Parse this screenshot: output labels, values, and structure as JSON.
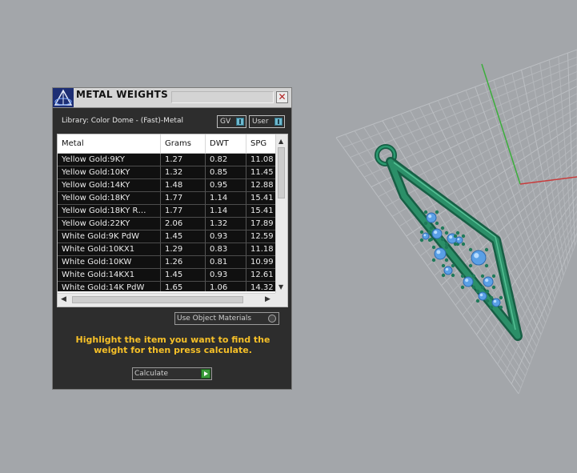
{
  "panel": {
    "title": "METAL WEIGHTS",
    "close_glyph": "✕",
    "library_label": "Library: Color Dome - (Fast)-Metal",
    "toggles": [
      {
        "label": "GV",
        "icon": "toggle-icon"
      },
      {
        "label": "User",
        "icon": "toggle-icon"
      }
    ],
    "table": {
      "columns": [
        "Metal",
        "Grams",
        "DWT",
        "SPG"
      ],
      "rows": [
        [
          "Yellow Gold:9KY",
          "1.27",
          "0.82",
          "11.08"
        ],
        [
          "Yellow Gold:10KY",
          "1.32",
          "0.85",
          "11.45"
        ],
        [
          "Yellow Gold:14KY",
          "1.48",
          "0.95",
          "12.88"
        ],
        [
          "Yellow Gold:18KY",
          "1.77",
          "1.14",
          "15.41"
        ],
        [
          "Yellow Gold:18KY R…",
          "1.77",
          "1.14",
          "15.41"
        ],
        [
          "Yellow Gold:22KY",
          "2.06",
          "1.32",
          "17.89"
        ],
        [
          "White Gold:9K PdW",
          "1.45",
          "0.93",
          "12.59"
        ],
        [
          "White Gold:10KX1",
          "1.29",
          "0.83",
          "11.18"
        ],
        [
          "White Gold:10KW",
          "1.26",
          "0.81",
          "10.99"
        ],
        [
          "White Gold:14KX1",
          "1.45",
          "0.93",
          "12.61"
        ],
        [
          "White Gold:14K PdW",
          "1.65",
          "1.06",
          "14.32"
        ]
      ]
    },
    "use_object_materials": "Use Object Materials",
    "hint": "Highlight the item you want to find the weight for then press calculate.",
    "calculate_label": "Calculate"
  },
  "colors": {
    "viewport_bg": "#a3a6aa",
    "panel_bg": "#2d2d2d",
    "hint_text": "#f6c028",
    "model_green": "#1f7a5a",
    "gem_blue": "#5aa0e6",
    "axis_green": "#3cae3c",
    "axis_red": "#c83c3c"
  }
}
